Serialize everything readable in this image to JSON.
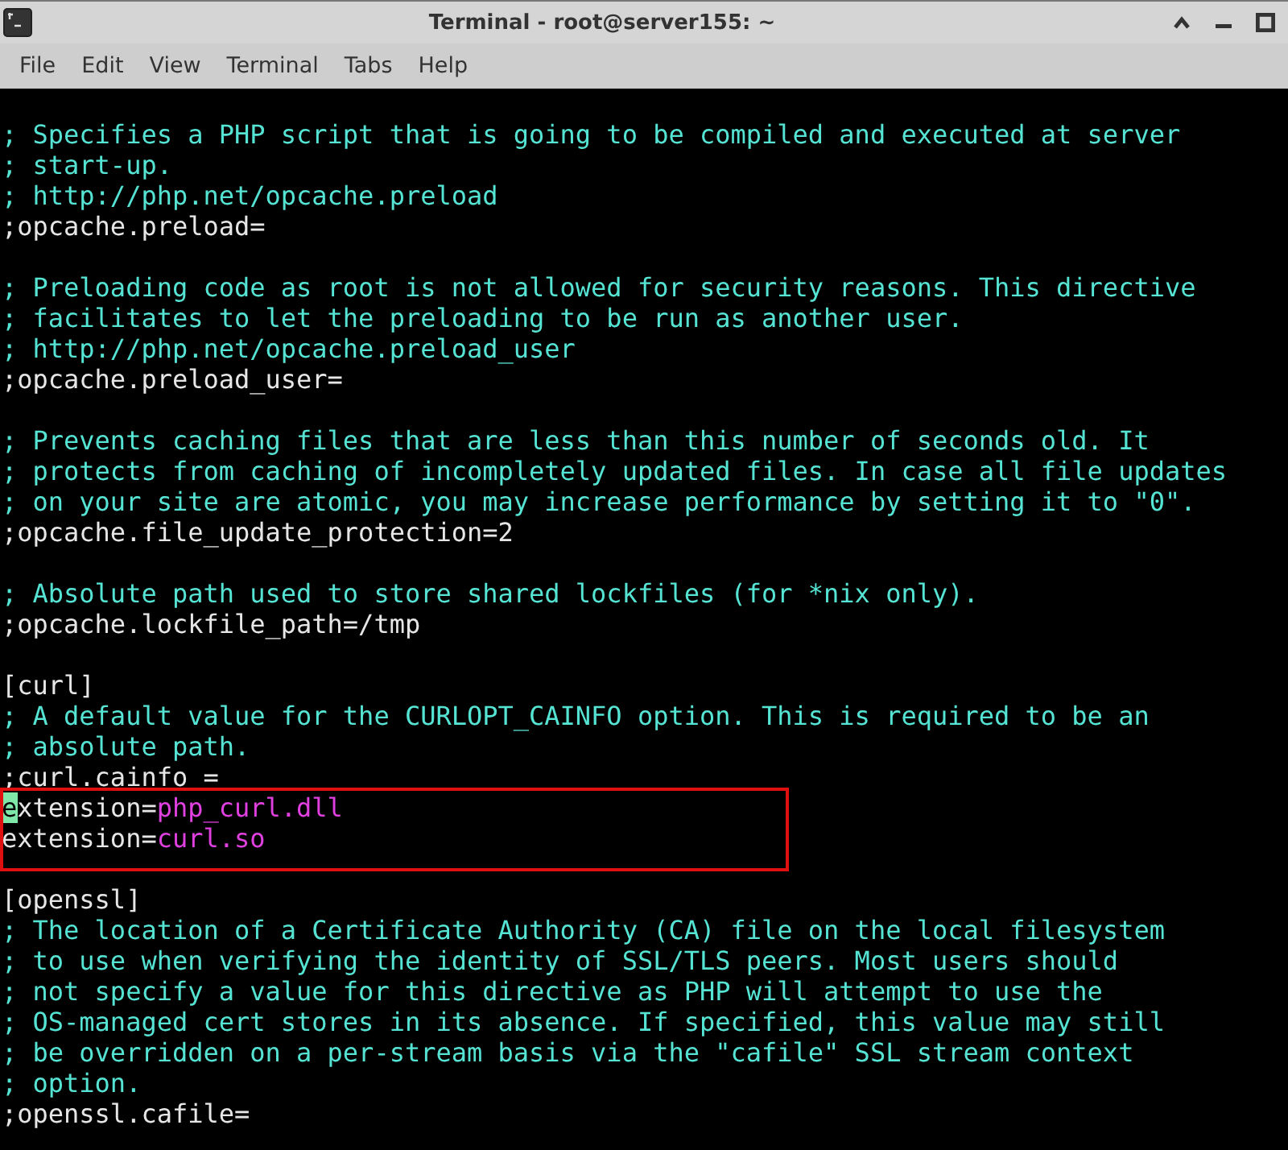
{
  "window": {
    "title": "Terminal - root@server155: ~"
  },
  "menu": [
    "File",
    "Edit",
    "View",
    "Terminal",
    "Tabs",
    "Help"
  ],
  "lines": [
    {
      "kind": "comment",
      "text": "; Specifies a PHP script that is going to be compiled and executed at server"
    },
    {
      "kind": "comment",
      "text": "; start-up."
    },
    {
      "kind": "comment",
      "text": "; http://php.net/opcache.preload"
    },
    {
      "kind": "directive",
      "text": ";opcache.preload="
    },
    {
      "kind": "blank"
    },
    {
      "kind": "comment",
      "text": "; Preloading code as root is not allowed for security reasons. This directive"
    },
    {
      "kind": "comment",
      "text": "; facilitates to let the preloading to be run as another user."
    },
    {
      "kind": "comment",
      "text": "; http://php.net/opcache.preload_user"
    },
    {
      "kind": "directive",
      "text": ";opcache.preload_user="
    },
    {
      "kind": "blank"
    },
    {
      "kind": "comment",
      "text": "; Prevents caching files that are less than this number of seconds old. It"
    },
    {
      "kind": "comment",
      "text": "; protects from caching of incompletely updated files. In case all file updates"
    },
    {
      "kind": "comment",
      "text": "; on your site are atomic, you may increase performance by setting it to \"0\"."
    },
    {
      "kind": "directive",
      "text": ";opcache.file_update_protection=2"
    },
    {
      "kind": "blank"
    },
    {
      "kind": "comment",
      "text": "; Absolute path used to store shared lockfiles (for *nix only)."
    },
    {
      "kind": "directive",
      "text": ";opcache.lockfile_path=/tmp"
    },
    {
      "kind": "blank"
    },
    {
      "kind": "section",
      "text": "[curl]"
    },
    {
      "kind": "comment",
      "text": "; A default value for the CURLOPT_CAINFO option. This is required to be an"
    },
    {
      "kind": "comment",
      "text": "; absolute path."
    },
    {
      "kind": "directive",
      "text": ";curl.cainfo ="
    },
    {
      "kind": "setting",
      "key": "extension=",
      "value": "php_curl.dll",
      "cursor": true,
      "highlighted": true
    },
    {
      "kind": "setting",
      "key": "extension=",
      "value": "curl.so",
      "cursor": false,
      "highlighted": true
    },
    {
      "kind": "blank"
    },
    {
      "kind": "section",
      "text": "[openssl]"
    },
    {
      "kind": "comment",
      "text": "; The location of a Certificate Authority (CA) file on the local filesystem"
    },
    {
      "kind": "comment",
      "text": "; to use when verifying the identity of SSL/TLS peers. Most users should"
    },
    {
      "kind": "comment",
      "text": "; not specify a value for this directive as PHP will attempt to use the"
    },
    {
      "kind": "comment",
      "text": "; OS-managed cert stores in its absence. If specified, this value may still"
    },
    {
      "kind": "comment",
      "text": "; be overridden on a per-stream basis via the \"cafile\" SSL stream context"
    },
    {
      "kind": "comment",
      "text": "; option."
    },
    {
      "kind": "directive",
      "text": ";openssl.cafile="
    }
  ]
}
